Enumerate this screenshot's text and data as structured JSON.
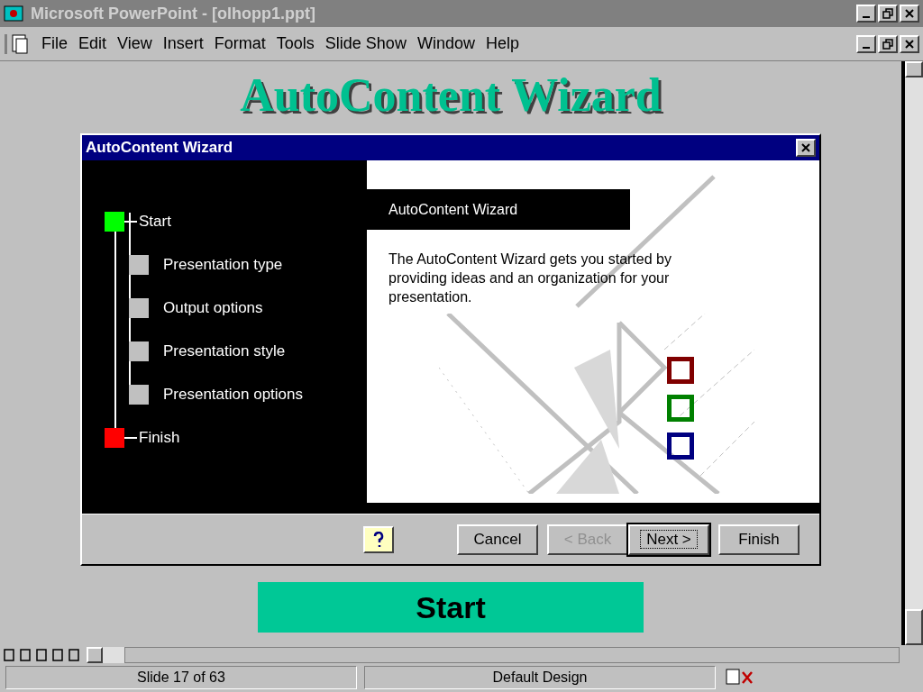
{
  "window": {
    "title": "Microsoft PowerPoint - [olhopp1.ppt]"
  },
  "menu": [
    "File",
    "Edit",
    "View",
    "Insert",
    "Format",
    "Tools",
    "Slide Show",
    "Window",
    "Help"
  ],
  "slide": {
    "heading": "AutoContent Wizard",
    "caption": "Start"
  },
  "dialog": {
    "title": "AutoContent Wizard",
    "panel_title": "AutoContent Wizard",
    "description": "The AutoContent Wizard gets you started by providing ideas and an organization for your presentation.",
    "steps": [
      {
        "label": "Start",
        "kind": "endpoint",
        "color": "#00ff00"
      },
      {
        "label": "Presentation type",
        "kind": "step",
        "color": "#c0c0c0"
      },
      {
        "label": "Output options",
        "kind": "step",
        "color": "#c0c0c0"
      },
      {
        "label": "Presentation style",
        "kind": "step",
        "color": "#c0c0c0"
      },
      {
        "label": "Presentation options",
        "kind": "step",
        "color": "#c0c0c0"
      },
      {
        "label": "Finish",
        "kind": "endpoint",
        "color": "#ff0000"
      }
    ],
    "buttons": [
      {
        "label": "Cancel",
        "disabled": false,
        "default": false
      },
      {
        "label": "< Back",
        "disabled": true,
        "default": false
      },
      {
        "label": "Next >",
        "disabled": false,
        "default": true
      },
      {
        "label": "Finish",
        "disabled": false,
        "default": false
      }
    ]
  },
  "status_bar": [
    "Slide 17 of 63",
    "Default Design"
  ]
}
